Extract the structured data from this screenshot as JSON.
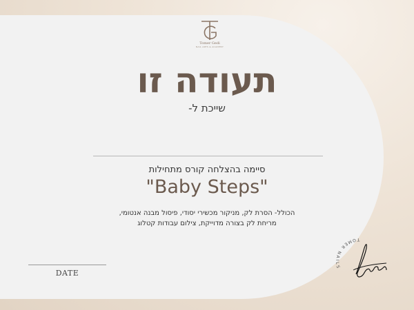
{
  "logo": {
    "monogram": "TG",
    "name": "Tomer Gedi",
    "tagline": "NAIL ARTS & ACADEMY"
  },
  "certificate": {
    "title": "תעודה זו",
    "subtitle": "שייכת ל-",
    "completion": "סיימה בהצלחה קורס מתחילות",
    "course": "\"Baby Steps\"",
    "description_line1": "הכולל- הסרת לק, מניקור מכשירי יסודי, פיסול מבנה אנטומי,",
    "description_line2": "מריחת לק בצורה מדוייקת, צילום עבודות קטלוג",
    "date_label": "DATE"
  },
  "stamp": {
    "text": "TOMER NAILS"
  },
  "colors": {
    "accent": "#6b5a4e",
    "card": "#f2f2f2",
    "background": "#eee3d6"
  }
}
